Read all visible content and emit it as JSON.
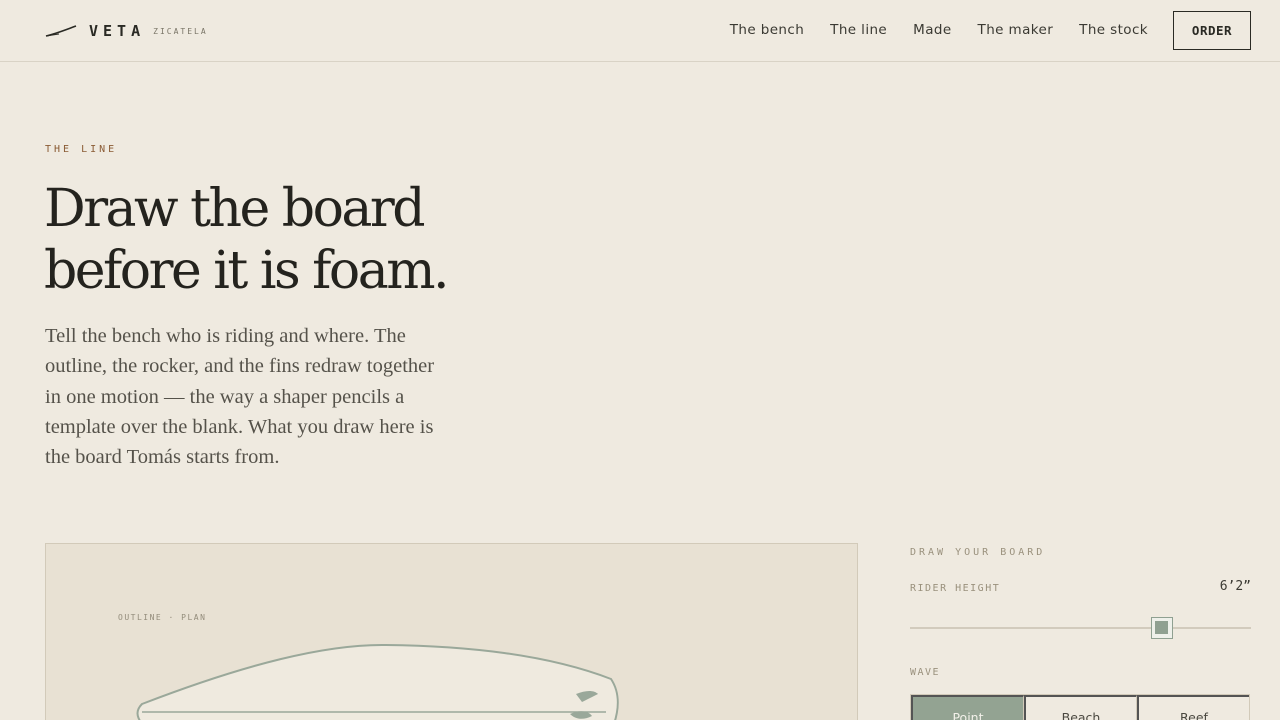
{
  "header": {
    "brand_name": "VETA",
    "brand_sub": "ZICATELA",
    "nav": [
      "The bench",
      "The line",
      "Made",
      "The maker",
      "The stock"
    ],
    "order_label": "ORDER"
  },
  "hero": {
    "eyebrow": "THE LINE",
    "headline_line1": "Draw the board",
    "headline_line2": "before it is foam.",
    "lede": "Tell the bench who is riding and where. The outline, the rocker, and the fins redraw together in one motion — the way a shaper pencils a template over the blank. What you draw here is the board Tomás starts from."
  },
  "canvas": {
    "label": "OUTLINE · PLAN"
  },
  "controls": {
    "title": "DRAW YOUR BOARD",
    "rider_height_label": "RIDER HEIGHT",
    "rider_height_value": "6’2”",
    "rider_height_fraction": 0.74,
    "wave_label": "WAVE",
    "wave_options": [
      "Point",
      "Beach",
      "Reef"
    ],
    "wave_selected": "Point"
  },
  "colors": {
    "accent": "#93a392",
    "background": "#efeae0",
    "panel": "#e8e1d3"
  }
}
